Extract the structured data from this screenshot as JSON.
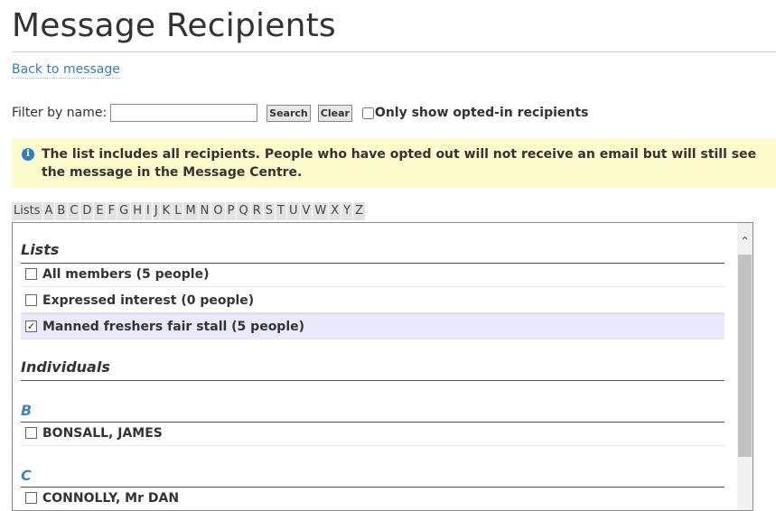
{
  "page": {
    "title": "Message Recipients",
    "back_link": "Back to message"
  },
  "filter": {
    "label": "Filter by name:",
    "value": "",
    "search_label": "Search",
    "clear_label": "Clear",
    "opted_in_label": "Only show opted-in recipients",
    "opted_in_checked": false
  },
  "info": {
    "icon": "info-icon",
    "text": "The list includes all recipients. People who have opted out will not receive an email but will still see the message in the Message Centre."
  },
  "alphabet": [
    "Lists",
    "A",
    "B",
    "C",
    "D",
    "E",
    "F",
    "G",
    "H",
    "I",
    "J",
    "K",
    "L",
    "M",
    "N",
    "O",
    "P",
    "Q",
    "R",
    "S",
    "T",
    "U",
    "V",
    "W",
    "X",
    "Y",
    "Z"
  ],
  "lists_section": {
    "heading": "Lists",
    "items": [
      {
        "label": "All members (5 people)",
        "checked": false
      },
      {
        "label": "Expressed interest (0 people)",
        "checked": false
      },
      {
        "label": "Manned freshers fair stall (5 people)",
        "checked": true
      }
    ]
  },
  "individuals_section": {
    "heading": "Individuals",
    "groups": [
      {
        "letter": "B",
        "items": [
          {
            "label": "BONSALL, JAMES",
            "checked": false
          }
        ]
      },
      {
        "letter": "C",
        "items": [
          {
            "label": "CONNOLLY, Mr DAN",
            "checked": false
          }
        ]
      }
    ]
  },
  "colors": {
    "link": "#2f7fc7",
    "info_bg": "#fefccd",
    "letter_heading": "#3a86c8",
    "selected_row": "#e9e9fb"
  }
}
